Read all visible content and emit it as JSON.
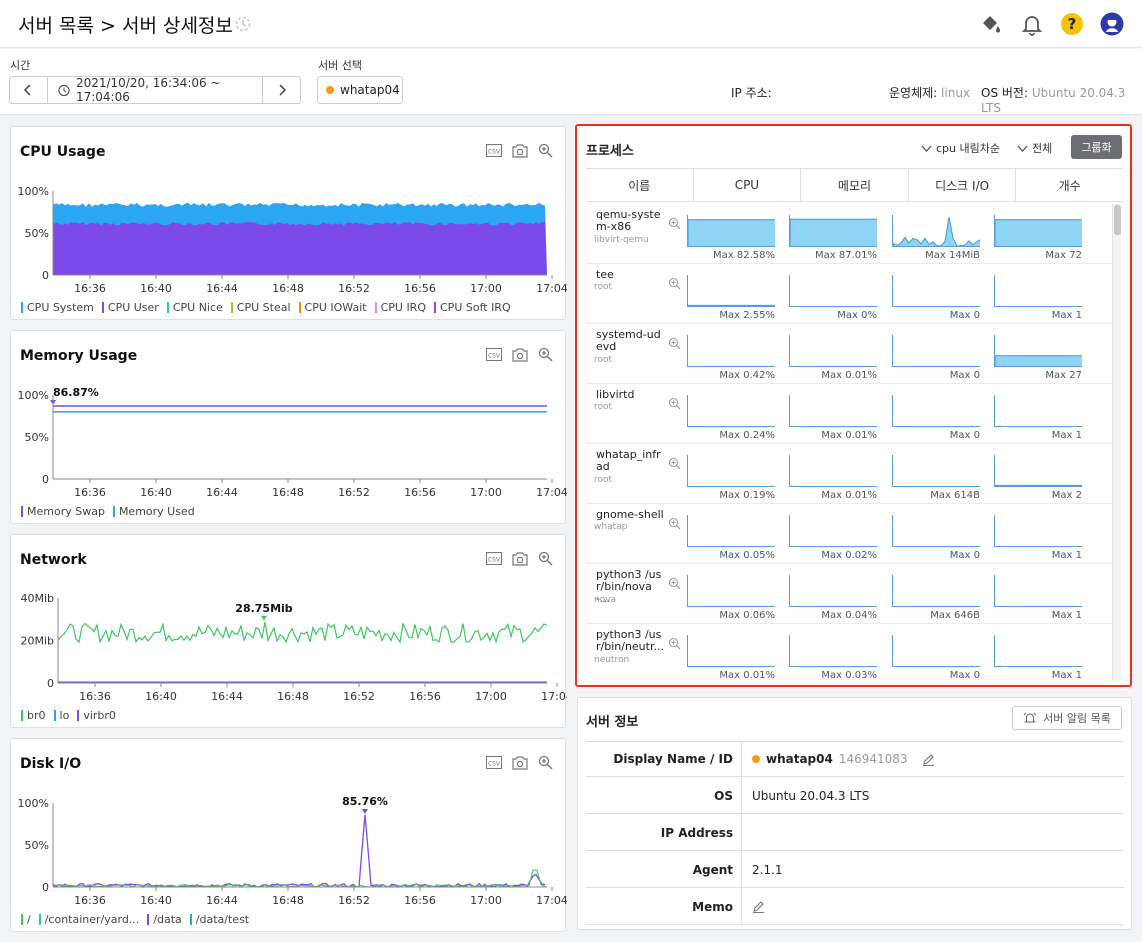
{
  "header": {
    "breadcrumb": "서버 목록 > 서버 상세정보"
  },
  "filters": {
    "time_label": "시간",
    "time_range": "2021/10/20, 16:34:06 ~ 17:04:06",
    "server_label": "서버 선택",
    "server_value": "whatap04",
    "ip_label": "IP 주소:",
    "os_label": "운영체제:",
    "os_value": "linux",
    "os_version_label": "OS 버전:",
    "os_version_value": "Ubuntu 20.04.3 LTS"
  },
  "time_ticks": [
    "16:36",
    "16:40",
    "16:44",
    "16:48",
    "16:52",
    "16:56",
    "17:00",
    "17:04"
  ],
  "cpu": {
    "title": "CPU Usage",
    "yticks": [
      "100%",
      "50%",
      "0"
    ],
    "legend": [
      {
        "name": "CPU System",
        "color": "#29a3ef"
      },
      {
        "name": "CPU User",
        "color": "#7b4be8"
      },
      {
        "name": "CPU Nice",
        "color": "#2ec4b6"
      },
      {
        "name": "CPU Steal",
        "color": "#9bc53d"
      },
      {
        "name": "CPU IOWait",
        "color": "#f08c00"
      },
      {
        "name": "CPU IRQ",
        "color": "#e58ee8"
      },
      {
        "name": "CPU Soft IRQ",
        "color": "#b23ed1"
      }
    ]
  },
  "memory": {
    "title": "Memory Usage",
    "yticks": [
      "100%",
      "50%",
      "0"
    ],
    "peak_label": "86.87%",
    "legend": [
      {
        "name": "Memory Swap",
        "color": "#7b4be8"
      },
      {
        "name": "Memory Used",
        "color": "#29a3ef"
      }
    ]
  },
  "network": {
    "title": "Network",
    "yticks": [
      "40Mib",
      "20Mib",
      "0"
    ],
    "peak_label": "28.75Mib",
    "legend": [
      {
        "name": "br0",
        "color": "#3cc761"
      },
      {
        "name": "lo",
        "color": "#29a3ef"
      },
      {
        "name": "virbr0",
        "color": "#7b4be8"
      }
    ]
  },
  "disk": {
    "title": "Disk I/O",
    "yticks": [
      "100%",
      "50%",
      "0"
    ],
    "peak_label": "85.76%",
    "legend": [
      {
        "name": "/",
        "color": "#3cc761"
      },
      {
        "name": "/container/yard...",
        "color": "#2ec4b6"
      },
      {
        "name": "/data",
        "color": "#7b4be8"
      },
      {
        "name": "/data/test",
        "color": "#29a3ef"
      }
    ]
  },
  "process": {
    "title": "프로세스",
    "sort_label": "cpu 내림차순",
    "filter_label": "전체",
    "group_button": "그룹화",
    "columns": [
      "이름",
      "CPU",
      "메모리",
      "디스크 I/O",
      "개수"
    ],
    "rows": [
      {
        "name": "qemu-system-x86",
        "user": "libvirt-qemu",
        "cpu": "82.58%",
        "mem": "87.01%",
        "disk": "14MiB",
        "count": "72",
        "cpu_level": 0.85,
        "mem_level": 0.87,
        "disk_level": 0.25,
        "count_level": 0.85
      },
      {
        "name": "tee",
        "user": "root",
        "cpu": "2.55%",
        "mem": "0%",
        "disk": "0",
        "count": "1",
        "cpu_level": 0.05,
        "mem_level": 0,
        "disk_level": 0,
        "count_level": 0
      },
      {
        "name": "systemd-udevd",
        "user": "root",
        "cpu": "0.42%",
        "mem": "0.01%",
        "disk": "0",
        "count": "27",
        "cpu_level": 0,
        "mem_level": 0,
        "disk_level": 0,
        "count_level": 0.35
      },
      {
        "name": "libvirtd",
        "user": "root",
        "cpu": "0.24%",
        "mem": "0.01%",
        "disk": "0",
        "count": "1",
        "cpu_level": 0,
        "mem_level": 0,
        "disk_level": 0,
        "count_level": 0
      },
      {
        "name": "whatap_infrad",
        "user": "root",
        "cpu": "0.19%",
        "mem": "0.01%",
        "disk": "614B",
        "count": "2",
        "cpu_level": 0,
        "mem_level": 0,
        "disk_level": 0,
        "count_level": 0.05
      },
      {
        "name": "gnome-shell",
        "user": "whatap",
        "cpu": "0.05%",
        "mem": "0.02%",
        "disk": "0",
        "count": "1",
        "cpu_level": 0,
        "mem_level": 0,
        "disk_level": 0,
        "count_level": 0
      },
      {
        "name": "python3 /usr/bin/nova-...",
        "user": "nova",
        "cpu": "0.06%",
        "mem": "0.04%",
        "disk": "646B",
        "count": "1",
        "cpu_level": 0,
        "mem_level": 0,
        "disk_level": 0,
        "count_level": 0
      },
      {
        "name": "python3 /usr/bin/neutr...",
        "user": "neutron",
        "cpu": "0.01%",
        "mem": "0.03%",
        "disk": "0",
        "count": "1",
        "cpu_level": 0,
        "mem_level": 0,
        "disk_level": 0,
        "count_level": 0
      }
    ],
    "max_label": "Max"
  },
  "server_info": {
    "title": "서버 정보",
    "alert_button": "서버 알림 목록",
    "display_name_key": "Display Name / ID",
    "display_name": "whatap04",
    "display_id": "146941083",
    "os_key": "OS",
    "os_value": "Ubuntu 20.04.3 LTS",
    "ip_key": "IP Address",
    "ip_value": "",
    "agent_key": "Agent",
    "agent_value": "2.1.1",
    "memo_key": "Memo"
  },
  "accent": {
    "orange": "#f39c12",
    "highlight": "#e8331f"
  }
}
